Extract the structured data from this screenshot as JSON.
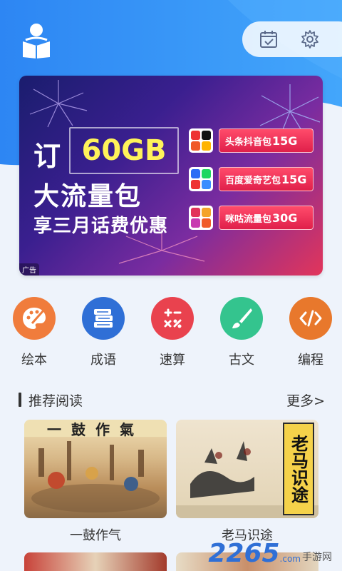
{
  "colors": {
    "header_blue": "#2f8cf5",
    "page_bg": "#eef3fb",
    "cat_huiben": "#f07c3c",
    "cat_chengyu": "#2f6fd6",
    "cat_susuan": "#e9424e",
    "cat_guwen": "#34c48e",
    "cat_biancheng": "#e8782c"
  },
  "header": {
    "logo_icon": "reading-child-icon",
    "calendar_icon": "calendar-check-icon",
    "settings_icon": "gear-icon"
  },
  "banner": {
    "ding": "订",
    "gb": "60GB",
    "line2": "大流量包",
    "line3": "享三月话费优惠",
    "packages": [
      {
        "name": "头条抖音包",
        "size": "15G"
      },
      {
        "name": "百度爱奇艺包",
        "size": "15G"
      },
      {
        "name": "咪咕流量包",
        "size": "30G"
      }
    ],
    "ad_label": "广告"
  },
  "categories": [
    {
      "label": "绘本",
      "icon": "paint-palette-icon"
    },
    {
      "label": "成语",
      "icon": "book-stack-icon"
    },
    {
      "label": "速算",
      "icon": "calculator-icon"
    },
    {
      "label": "古文",
      "icon": "brush-icon"
    },
    {
      "label": "编程",
      "icon": "code-icon"
    }
  ],
  "recommend": {
    "title": "推荐阅读",
    "more": "更多>",
    "items": [
      {
        "caption": "一鼓作气",
        "image_text": "一鼓作氣"
      },
      {
        "caption": "老马识途",
        "image_text": "老马识途"
      }
    ]
  },
  "watermark": {
    "num": "2265",
    "suffix": ".com",
    "text": "手游网"
  }
}
